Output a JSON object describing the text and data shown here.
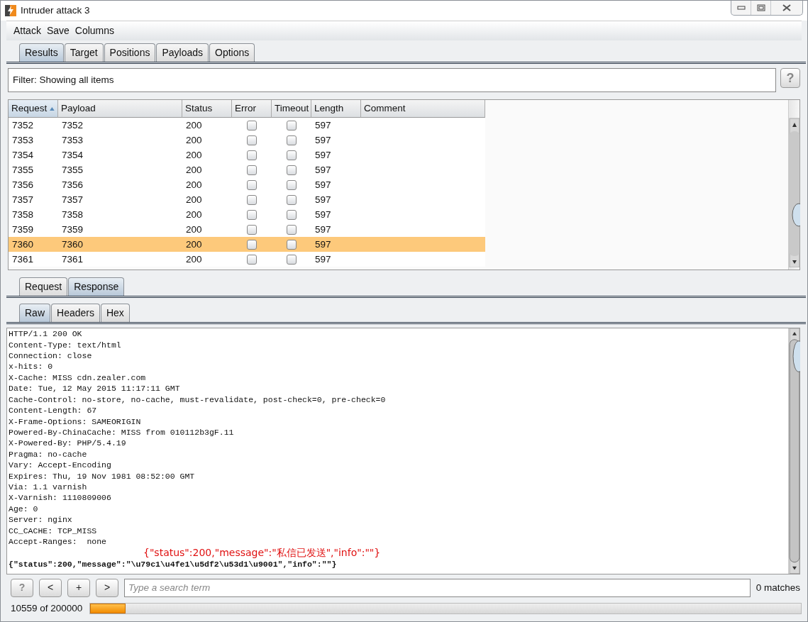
{
  "window": {
    "title": "Intruder attack 3"
  },
  "menu": [
    "Attack",
    "Save",
    "Columns"
  ],
  "tabs": [
    {
      "label": "Results",
      "selected": true
    },
    {
      "label": "Target",
      "selected": false
    },
    {
      "label": "Positions",
      "selected": false
    },
    {
      "label": "Payloads",
      "selected": false
    },
    {
      "label": "Options",
      "selected": false
    }
  ],
  "filter": {
    "text": "Filter: Showing all items",
    "help": "?"
  },
  "table": {
    "columns": [
      {
        "label": "Request",
        "sorted": true
      },
      {
        "label": "Payload",
        "sorted": false
      },
      {
        "label": "Status",
        "sorted": false
      },
      {
        "label": "Error",
        "sorted": false
      },
      {
        "label": "Timeout",
        "sorted": false
      },
      {
        "label": "Length",
        "sorted": false
      },
      {
        "label": "Comment",
        "sorted": false
      }
    ],
    "rows": [
      {
        "request": "7352",
        "payload": "7352",
        "status": "200",
        "error": false,
        "timeout": false,
        "length": "597",
        "selected": false
      },
      {
        "request": "7353",
        "payload": "7353",
        "status": "200",
        "error": false,
        "timeout": false,
        "length": "597",
        "selected": false
      },
      {
        "request": "7354",
        "payload": "7354",
        "status": "200",
        "error": false,
        "timeout": false,
        "length": "597",
        "selected": false
      },
      {
        "request": "7355",
        "payload": "7355",
        "status": "200",
        "error": false,
        "timeout": false,
        "length": "597",
        "selected": false
      },
      {
        "request": "7356",
        "payload": "7356",
        "status": "200",
        "error": false,
        "timeout": false,
        "length": "597",
        "selected": false
      },
      {
        "request": "7357",
        "payload": "7357",
        "status": "200",
        "error": false,
        "timeout": false,
        "length": "597",
        "selected": false
      },
      {
        "request": "7358",
        "payload": "7358",
        "status": "200",
        "error": false,
        "timeout": false,
        "length": "597",
        "selected": false
      },
      {
        "request": "7359",
        "payload": "7359",
        "status": "200",
        "error": false,
        "timeout": false,
        "length": "597",
        "selected": false
      },
      {
        "request": "7360",
        "payload": "7360",
        "status": "200",
        "error": false,
        "timeout": false,
        "length": "597",
        "selected": true
      },
      {
        "request": "7361",
        "payload": "7361",
        "status": "200",
        "error": false,
        "timeout": false,
        "length": "597",
        "selected": false
      }
    ]
  },
  "message_tabs": [
    {
      "label": "Request",
      "selected": false
    },
    {
      "label": "Response",
      "selected": true
    }
  ],
  "view_tabs": [
    {
      "label": "Raw",
      "selected": true
    },
    {
      "label": "Headers",
      "selected": false
    },
    {
      "label": "Hex",
      "selected": false
    }
  ],
  "response_lines": [
    {
      "kind": "code",
      "text": "HTTP/1.1 200 OK"
    },
    {
      "kind": "code",
      "text": "Content-Type: text/html"
    },
    {
      "kind": "code",
      "text": "Connection: close"
    },
    {
      "kind": "code",
      "text": "x-hits: 0"
    },
    {
      "kind": "code",
      "text": "X-Cache: MISS cdn.zealer.com"
    },
    {
      "kind": "code",
      "text": "Date: Tue, 12 May 2015 11:17:11 GMT"
    },
    {
      "kind": "code",
      "text": "Cache-Control: no-store, no-cache, must-revalidate, post-check=0, pre-check=0"
    },
    {
      "kind": "code",
      "text": "Content-Length: 67"
    },
    {
      "kind": "code",
      "text": "X-Frame-Options: SAMEORIGIN"
    },
    {
      "kind": "code",
      "text": "Powered-By-ChinaCache: MISS from 010112b3gF.11"
    },
    {
      "kind": "code",
      "text": "X-Powered-By: PHP/5.4.19"
    },
    {
      "kind": "code",
      "text": "Pragma: no-cache"
    },
    {
      "kind": "code",
      "text": "Vary: Accept-Encoding"
    },
    {
      "kind": "code",
      "text": "Expires: Thu, 19 Nov 1981 08:52:00 GMT"
    },
    {
      "kind": "code",
      "text": "Via: 1.1 varnish"
    },
    {
      "kind": "code",
      "text": "X-Varnish: 1110809006"
    },
    {
      "kind": "code",
      "text": "Age: 0"
    },
    {
      "kind": "code",
      "text": "Server: nginx"
    },
    {
      "kind": "code",
      "text": "CC_CACHE: TCP_MISS"
    },
    {
      "kind": "code",
      "text": "Accept-Ranges:  none"
    },
    {
      "kind": "annotation",
      "text": "{\"status\":200,\"message\":\"私信已发送\",\"info\":\"\"}"
    },
    {
      "kind": "body",
      "text": "{\"status\":200,\"message\":\"\\u79c1\\u4fe1\\u5df2\\u53d1\\u9001\",\"info\":\"\"}"
    }
  ],
  "search": {
    "buttons": [
      "?",
      "<",
      "+",
      ">"
    ],
    "placeholder": "Type a search term",
    "matches": "0 matches"
  },
  "status_bar": {
    "count": "10559 of 200000",
    "level": 0.05
  }
}
